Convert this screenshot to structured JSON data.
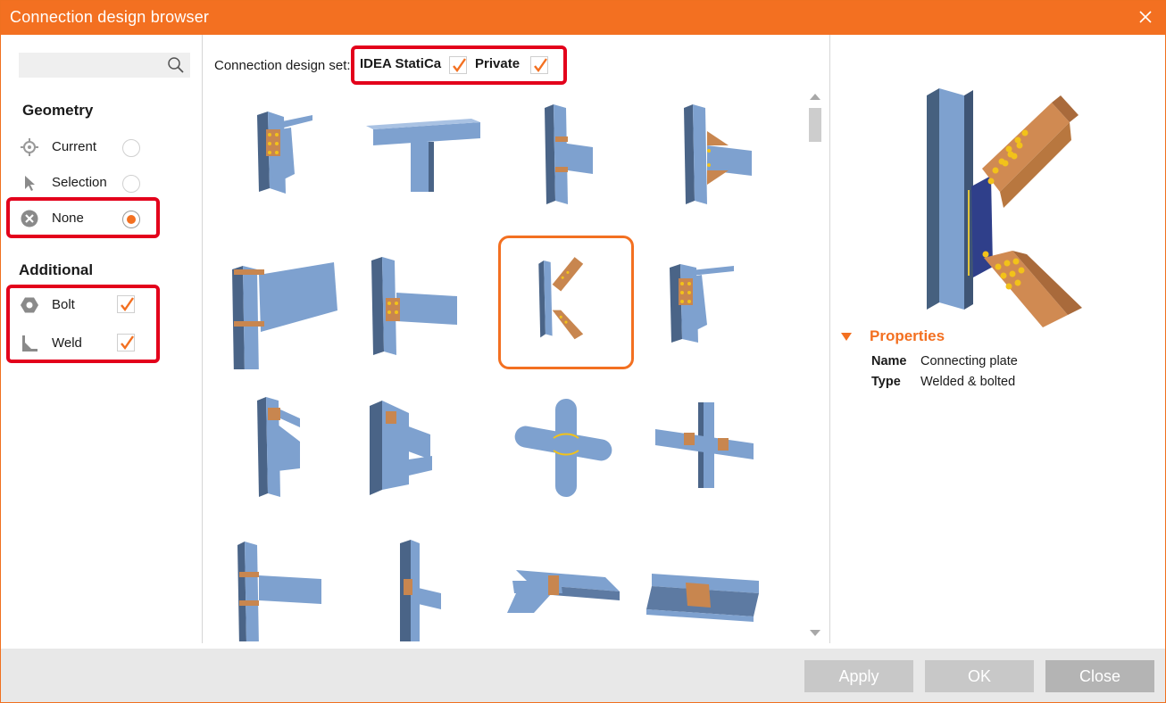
{
  "window": {
    "title": "Connection design browser"
  },
  "sidebar": {
    "search": {
      "placeholder": ""
    },
    "geometry_title": "Geometry",
    "geometry_options": [
      {
        "label": "Current",
        "selected": false,
        "icon": "target-icon"
      },
      {
        "label": "Selection",
        "selected": false,
        "icon": "cursor-icon"
      },
      {
        "label": "None",
        "selected": true,
        "icon": "cross-circle-icon"
      }
    ],
    "additional_title": "Additional",
    "additional_options": [
      {
        "label": "Bolt",
        "checked": true,
        "icon": "bolt-hex-icon"
      },
      {
        "label": "Weld",
        "checked": true,
        "icon": "weld-icon"
      }
    ]
  },
  "design_set": {
    "label": "Connection design set:",
    "items": [
      {
        "label": "IDEA StatiCa",
        "checked": true
      },
      {
        "label": "Private",
        "checked": true
      }
    ]
  },
  "grid": {
    "selected_index": 6,
    "thumbnails": [
      "endplate-beam-to-column-icon",
      "tee-beam-icon",
      "beam-to-column-flange-icon",
      "beam-haunch-column-icon",
      "haunched-portal-frame-icon",
      "finplate-beam-column-icon",
      "connecting-plate-diagonals-icon",
      "double-endplate-icon",
      "stiffened-cleat-column-icon",
      "stiffened-cleat-box-icon",
      "circular-tube-cross-icon",
      "rectangular-tube-cross-icon",
      "column-beam-stiffeners-icon",
      "box-column-plate-icon",
      "beam-to-beam-cleat-icon",
      "beam-splice-plate-icon"
    ]
  },
  "properties": {
    "title": "Properties",
    "rows": [
      {
        "key": "Name",
        "value": "Connecting plate"
      },
      {
        "key": "Type",
        "value": "Welded & bolted"
      }
    ]
  },
  "footer": {
    "apply": "Apply",
    "ok": "OK",
    "close": "Close"
  },
  "colors": {
    "accent": "#f37021",
    "steel": "#7ea1cf",
    "plate": "#c8864f",
    "highlight": "#e3001b"
  }
}
